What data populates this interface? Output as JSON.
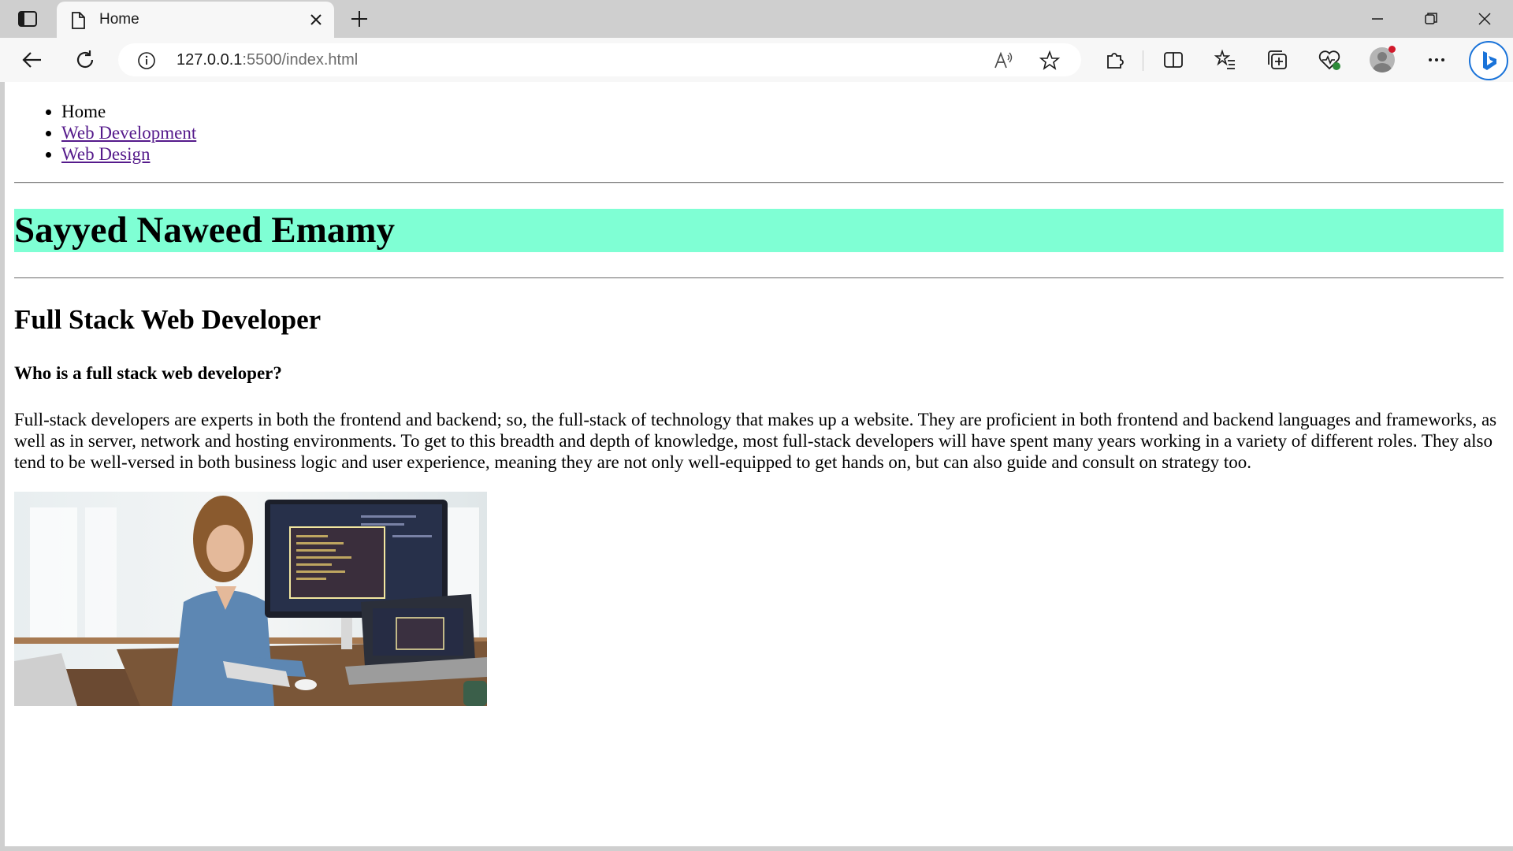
{
  "browser": {
    "tab_title": "Home",
    "url_host": "127.0.0.1",
    "url_path": ":5500/index.html"
  },
  "page": {
    "nav": {
      "items": [
        {
          "label": "Home",
          "link": false
        },
        {
          "label": "Web Development",
          "link": true
        },
        {
          "label": "Web Design",
          "link": true
        }
      ]
    },
    "name": "Sayyed Naweed Emamy",
    "role_title": "Full Stack Web Developer",
    "question": "Who is a full stack web developer?",
    "paragraph": "Full-stack developers are experts in both the frontend and backend; so, the full-stack of technology that makes up a website. They are proficient in both frontend and backend languages and frameworks, as well as in server, network and hosting environments. To get to this breadth and depth of knowledge, most full-stack developers will have spent many years working in a variety of different roles. They also tend to be well-versed in both business logic and user experience, meaning they are not only well-equipped to get hands on, but can also guide and consult on strategy too.",
    "name_banner_color": "#7fffd4",
    "link_color": "#551a8b"
  }
}
